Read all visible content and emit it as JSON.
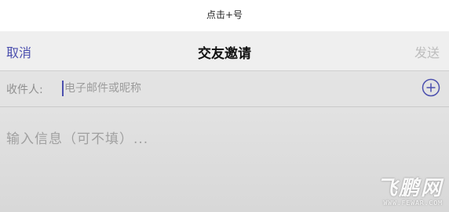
{
  "caption": "点击+号",
  "navbar": {
    "cancel_label": "取消",
    "title": "交友邀请",
    "send_label": "发送"
  },
  "recipient": {
    "label": "收件人:",
    "placeholder": "电子邮件或昵称",
    "value": "",
    "add_icon": "plus-circle-icon"
  },
  "message": {
    "placeholder": "输入信息（可不填）..."
  },
  "watermark": {
    "logo": "飞鹏网",
    "url": "WWW.FEWAR.COM"
  },
  "colors": {
    "accent": "#4b4fae",
    "disabled": "#bdbdbd"
  }
}
